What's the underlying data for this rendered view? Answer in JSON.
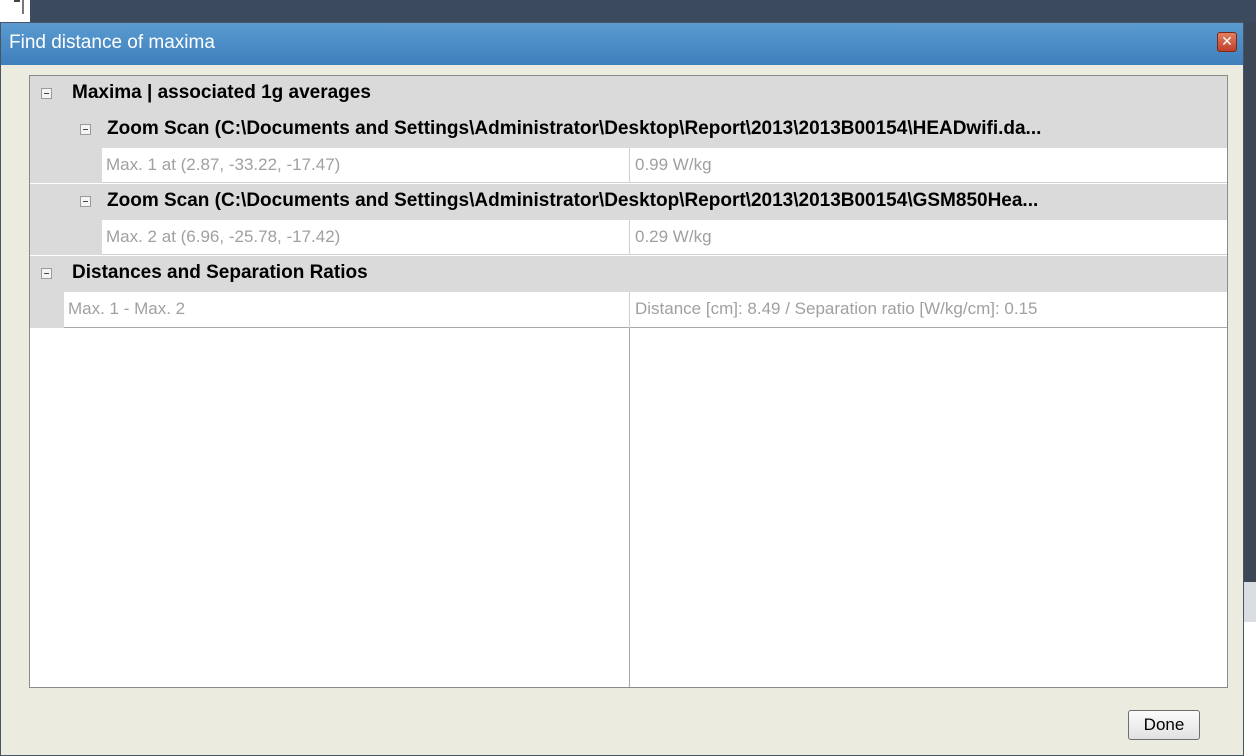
{
  "window": {
    "title": "Find distance of maxima",
    "close_icon": "close-icon"
  },
  "tree": {
    "group_maxima": "Maxima | associated 1g averages",
    "scan1": {
      "label": "Zoom Scan (C:\\Documents and Settings\\Administrator\\Desktop\\Report\\2013\\2013B00154\\HEADwifi.da...",
      "row": {
        "name": "Max. 1 at (2.87, -33.22, -17.47)",
        "value": "0.99 W/kg"
      }
    },
    "scan2": {
      "label": "Zoom Scan (C:\\Documents and Settings\\Administrator\\Desktop\\Report\\2013\\2013B00154\\GSM850Hea...",
      "row": {
        "name": "Max. 2 at (6.96, -25.78, -17.42)",
        "value": "0.29 W/kg"
      }
    },
    "group_distances": "Distances and Separation Ratios",
    "distance_row": {
      "name": "Max. 1 - Max. 2",
      "value": "Distance [cm]: 8.49 / Separation ratio [W/kg/cm]: 0.15"
    }
  },
  "buttons": {
    "done": "Done"
  }
}
